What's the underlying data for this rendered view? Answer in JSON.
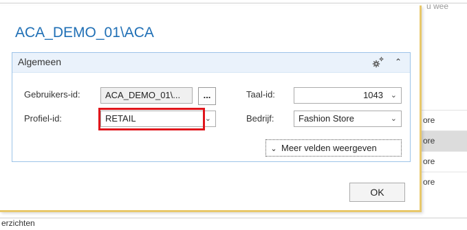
{
  "background": {
    "top_partial_text": "u wee",
    "list_items": [
      "ore",
      "ore",
      "ore",
      "ore"
    ],
    "selected_index": 1,
    "bottom_text": "erzichten"
  },
  "dialog": {
    "title": "ACA_DEMO_01\\ACA",
    "fasttab": {
      "title": "Algemeen",
      "gear_icon": "settings-gear-icon",
      "collapse_icon": "chevron-up-icon"
    },
    "fields": {
      "user_id_label": "Gebruikers-id:",
      "user_id_value": "ACA_DEMO_01\\...",
      "ellipsis_label": "...",
      "profile_id_label": "Profiel-id:",
      "profile_id_value": "RETAIL",
      "language_id_label": "Taal-id:",
      "language_id_value": "1043",
      "company_label": "Bedrijf:",
      "company_value": "Fashion Store"
    },
    "more_fields_label": "Meer velden weergeven",
    "ok_label": "OK",
    "highlight_color": "#e0151b",
    "accent_color": "#1f6fb5"
  }
}
